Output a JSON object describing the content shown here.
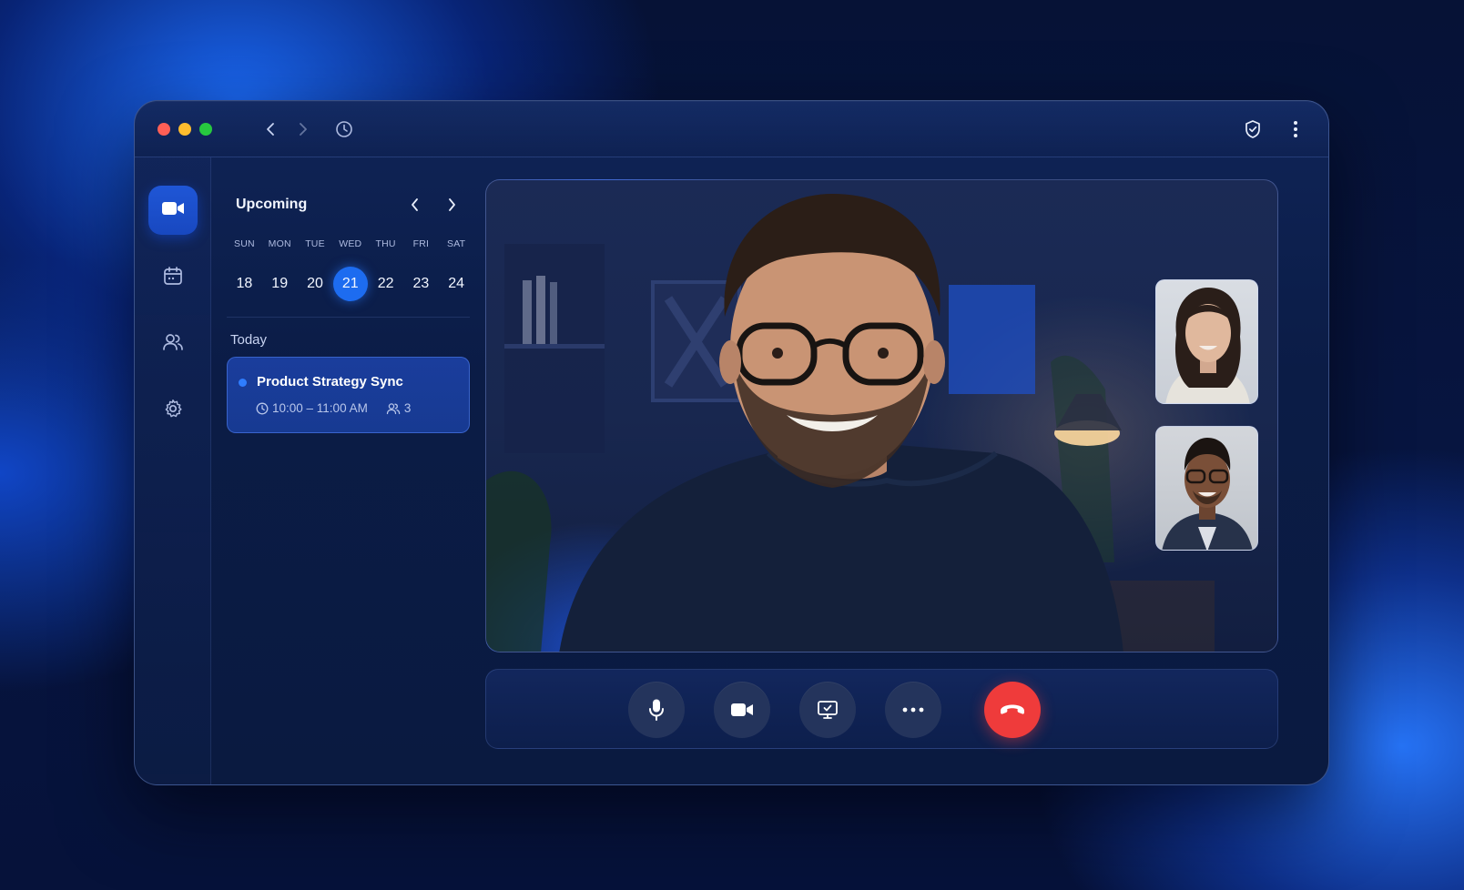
{
  "window": {
    "titlebar_icons": [
      "back-arrow-icon",
      "forward-arrow-icon",
      "history-clock-icon",
      "shield-check-icon",
      "kebab-menu-icon"
    ]
  },
  "sidebar": {
    "items": [
      {
        "icon": "video-camera-icon",
        "active": true
      },
      {
        "icon": "calendar-icon",
        "active": false
      },
      {
        "icon": "people-icon",
        "active": false
      },
      {
        "icon": "gear-icon",
        "active": false
      }
    ]
  },
  "calendar": {
    "title": "Upcoming",
    "weekdays": [
      "SUN",
      "MON",
      "TUE",
      "WED",
      "THU",
      "FRI",
      "SAT"
    ],
    "dates": [
      "18",
      "19",
      "20",
      "21",
      "22",
      "23",
      "24"
    ],
    "selected_date": "21"
  },
  "today": {
    "label": "Today",
    "event": {
      "title": "Product Strategy Sync",
      "time": "10:00 – 11:00 AM",
      "attendees": "3",
      "dot_color": "#2f7dff"
    }
  },
  "call": {
    "controls": [
      {
        "icon": "microphone-icon"
      },
      {
        "icon": "camera-icon"
      },
      {
        "icon": "screen-share-icon"
      },
      {
        "icon": "more-options-icon"
      },
      {
        "icon": "end-call-icon",
        "color": "#ef3b3b"
      }
    ]
  },
  "colors": {
    "accent": "#1d6cf0",
    "end_call": "#ef3b3b",
    "traffic_red": "#ff5f56",
    "traffic_yellow": "#ffbd2e",
    "traffic_green": "#27c93f"
  }
}
